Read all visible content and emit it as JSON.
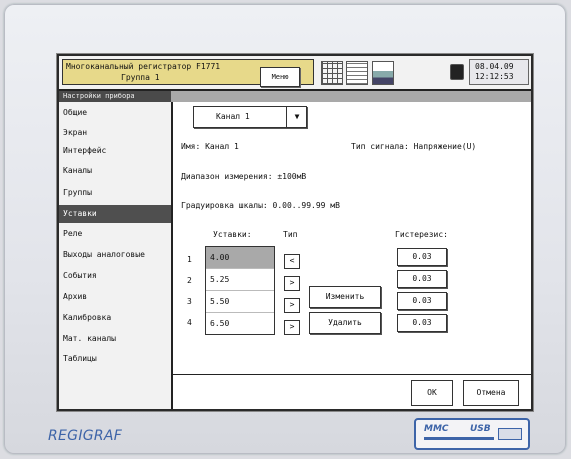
{
  "topbar": {
    "title_line1": "Многоканальный регистратор F1771",
    "title_line2": "Группа 1",
    "menu_label": "Меню",
    "date": "08.04.09",
    "time": "12:12:53",
    "icons": [
      "table-icon",
      "document-icon",
      "printer-icon",
      "lock-icon"
    ]
  },
  "section_title": "Настройки прибора",
  "sidebar": {
    "items": [
      {
        "label": "Общие"
      },
      {
        "label": "Экран"
      },
      {
        "label": "Интерфейс"
      },
      {
        "label": "Каналы"
      },
      {
        "label": "Группы"
      },
      {
        "label": "Уставки",
        "active": true
      },
      {
        "label": "Реле"
      },
      {
        "label": "Выходы аналоговые"
      },
      {
        "label": "События"
      },
      {
        "label": "Архив"
      },
      {
        "label": "Калибровка"
      },
      {
        "label": "Мат. каналы"
      },
      {
        "label": "Таблицы"
      }
    ]
  },
  "main": {
    "channel_select": "Канал 1",
    "name_line": "Имя: Канал 1",
    "signal_type": "Тип сигнала: Напряжение(U)",
    "range": "Диапазон измерения: ±100мВ",
    "scale": "Градуировка шкалы: 0.00..99.99 мВ",
    "col_setpoints": "Уставки:",
    "col_type": "Тип",
    "col_hysteresis": "Гистерезис:",
    "rows": [
      {
        "no": "1",
        "value": "4.00",
        "type": "<",
        "hyst": "0.03"
      },
      {
        "no": "2",
        "value": "5.25",
        "type": ">",
        "hyst": "0.03"
      },
      {
        "no": "3",
        "value": "5.50",
        "type": ">",
        "hyst": "0.03"
      },
      {
        "no": "4",
        "value": "6.50",
        "type": ">",
        "hyst": "0.03"
      }
    ],
    "edit_label": "Изменить",
    "delete_label": "Удалить",
    "ok_label": "ОК",
    "cancel_label": "Отмена"
  },
  "device": {
    "brand": "REGIGRAF",
    "slot_mmc": "MMC",
    "slot_usb": "USB"
  },
  "colors": {
    "title_bg": "#e7d98a",
    "active_item": "#4f4f4f",
    "brand": "#3d64a8"
  }
}
